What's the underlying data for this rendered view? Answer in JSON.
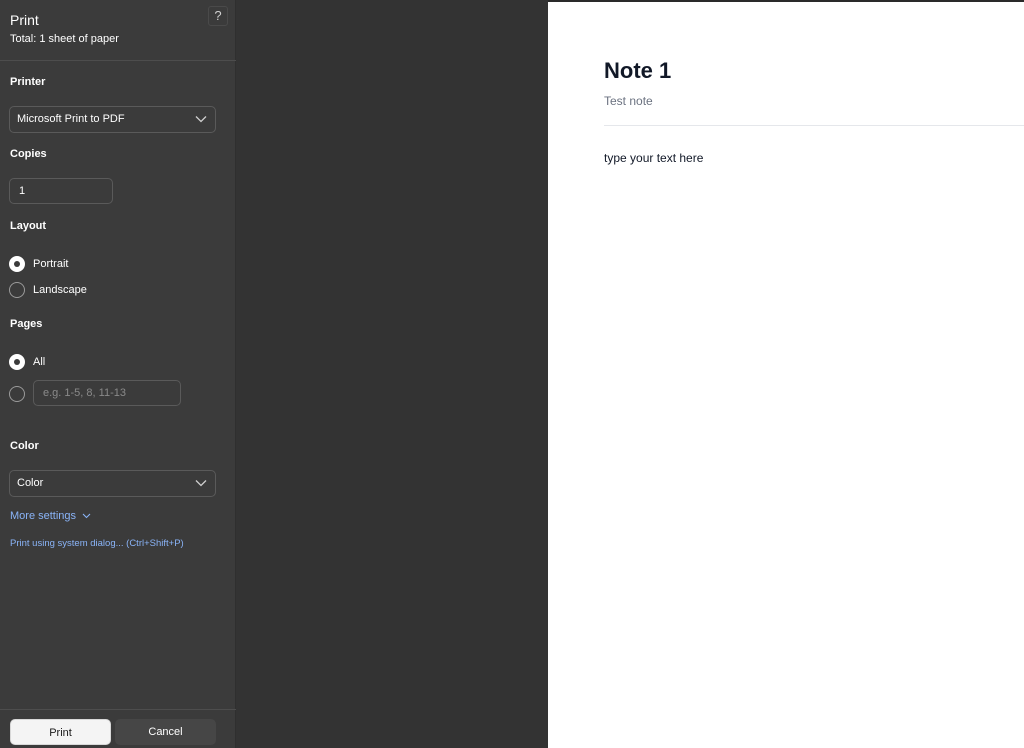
{
  "header": {
    "title": "Print",
    "subtitle": "Total: 1 sheet of paper",
    "help_label": "?"
  },
  "printer": {
    "label": "Printer",
    "selected": "Microsoft Print to PDF"
  },
  "copies": {
    "label": "Copies",
    "value": "1"
  },
  "layout": {
    "label": "Layout",
    "options": [
      "Portrait",
      "Landscape"
    ],
    "selected": "Portrait"
  },
  "pages": {
    "label": "Pages",
    "all_label": "All",
    "selected": "All",
    "custom_placeholder": "e.g. 1-5, 8, 11-13"
  },
  "color": {
    "label": "Color",
    "selected": "Color"
  },
  "links": {
    "more_settings": "More settings",
    "system_dialog": "Print using system dialog... (Ctrl+Shift+P)"
  },
  "footer": {
    "print_label": "Print",
    "cancel_label": "Cancel"
  },
  "preview": {
    "note_title": "Note 1",
    "note_subtitle": "Test note",
    "note_body": "type your text here"
  },
  "colors": {
    "panel_bg": "#3b3b3b",
    "preview_bg": "#333333",
    "link": "#8ab4f8",
    "page_bg": "#ffffff"
  },
  "icons": {
    "help": "help-icon",
    "dropdown": "chevron-down-icon",
    "more_settings": "chevron-down-icon"
  }
}
